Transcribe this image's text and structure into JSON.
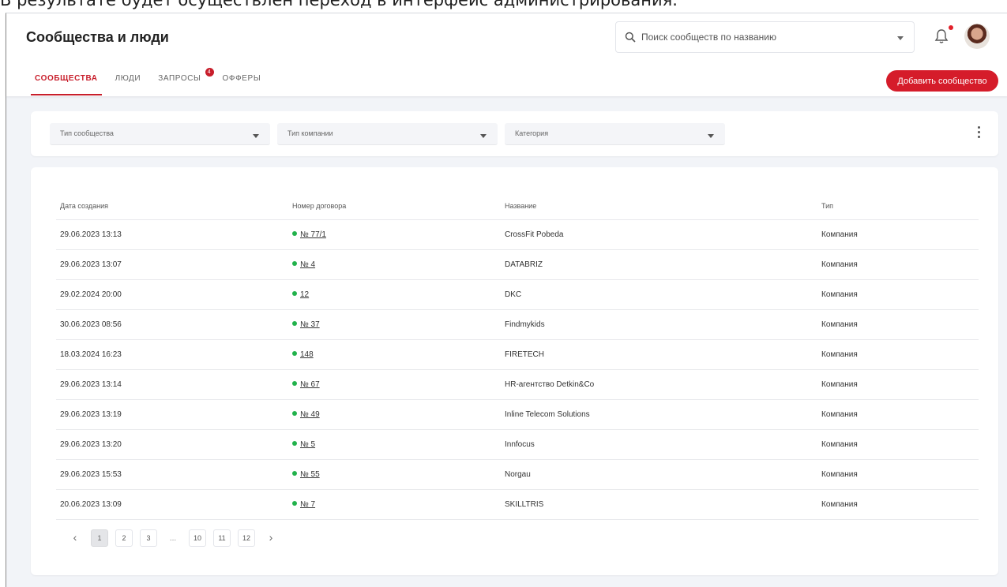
{
  "caption": "В результате будет осуществлен переход в интерфейс администрирования.",
  "header": {
    "title": "Сообщества и люди",
    "search_placeholder": "Поиск сообществ по названию"
  },
  "tabs": [
    {
      "label": "СООБЩЕСТВА",
      "active": true
    },
    {
      "label": "ЛЮДИ",
      "active": false
    },
    {
      "label": "ЗАПРОСЫ",
      "active": false,
      "badge": "4"
    },
    {
      "label": "ОФФЕРЫ",
      "active": false
    }
  ],
  "add_button": "Добавить сообщество",
  "filters": {
    "community_type": "Тип сообщества",
    "company_type": "Тип компании",
    "category": "Категория"
  },
  "table": {
    "headers": {
      "created": "Дата создания",
      "contract": "Номер договора",
      "name": "Название",
      "type": "Тип"
    },
    "rows": [
      {
        "created": "29.06.2023 13:13",
        "contract": "№ 77/1",
        "name": "CrossFit Pobeda",
        "type": "Компания"
      },
      {
        "created": "29.06.2023 13:07",
        "contract": "№ 4",
        "name": "DATABRIZ",
        "type": "Компания"
      },
      {
        "created": "29.02.2024 20:00",
        "contract": "12",
        "name": "DKC",
        "type": "Компания"
      },
      {
        "created": "30.06.2023 08:56",
        "contract": "№ 37",
        "name": "Findmykids",
        "type": "Компания"
      },
      {
        "created": "18.03.2024 16:23",
        "contract": "148",
        "name": "FIRETECH",
        "type": "Компания"
      },
      {
        "created": "29.06.2023 13:14",
        "contract": "№ 67",
        "name": "HR-агентство Detkin&Co",
        "type": "Компания"
      },
      {
        "created": "29.06.2023 13:19",
        "contract": "№ 49",
        "name": "Inline Telecom Solutions",
        "type": "Компания"
      },
      {
        "created": "29.06.2023 13:20",
        "contract": "№ 5",
        "name": "Innfocus",
        "type": "Компания"
      },
      {
        "created": "29.06.2023 15:53",
        "contract": "№ 55",
        "name": "Norgau",
        "type": "Компания"
      },
      {
        "created": "20.06.2023 13:09",
        "contract": "№ 7",
        "name": "SKILLTRIS",
        "type": "Компания"
      }
    ]
  },
  "pagination": {
    "prev": "‹",
    "next": "›",
    "ellipsis": "...",
    "pages": [
      "1",
      "2",
      "3",
      "10",
      "11",
      "12"
    ],
    "current": "1"
  },
  "colors": {
    "accent": "#d51c2a",
    "status_dot": "#22b24c",
    "background": "#f2f4f8"
  }
}
